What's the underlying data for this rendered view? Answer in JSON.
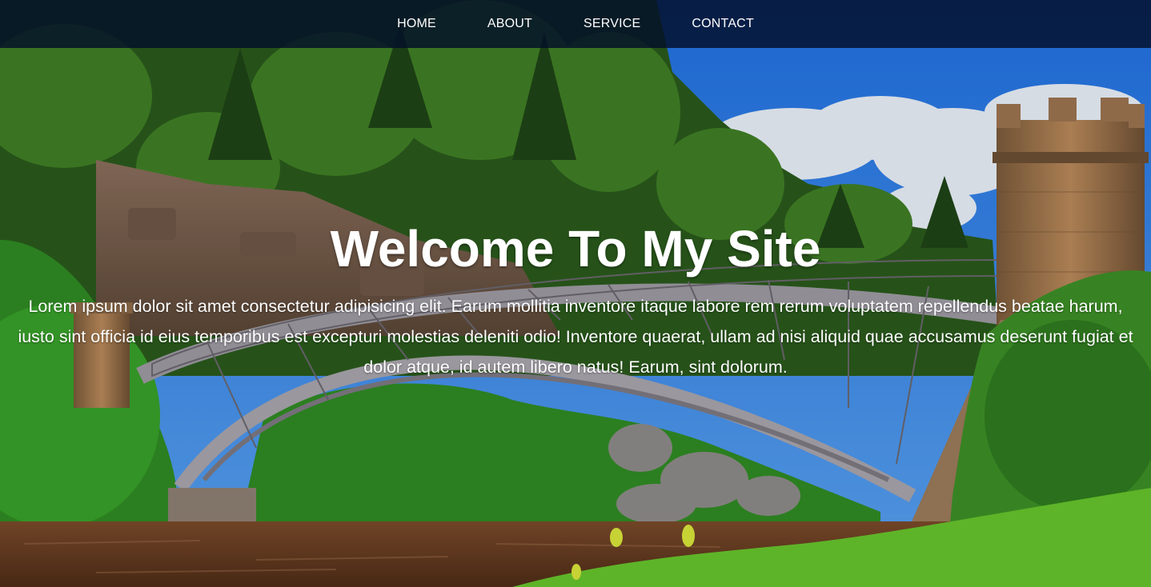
{
  "nav": {
    "items": [
      {
        "label": "HOME"
      },
      {
        "label": "ABOUT"
      },
      {
        "label": "SERVICE"
      },
      {
        "label": "CONTACT"
      }
    ]
  },
  "hero": {
    "title": "Welcome To My Site",
    "text": "Lorem ipsum dolor sit amet consectetur adipisicing elit. Earum mollitia inventore itaque labore rem rerum voluptatem repellendus beatae harum, iusto sint officia id eius temporibus est excepturi molestias deleniti odio! Inventore quaerat, ullam ad nisi aliquid quae accusamus deserunt fugiat et dolor atque, id autem libero natus! Earum, sint dolorum.",
    "background_image": "forest-bridge-castle-landscape"
  },
  "colors": {
    "navbar_bg": "#020e28",
    "text": "#ffffff",
    "sky": "#2f7ee8",
    "forest": "#2d6b1f",
    "river": "#6b3f24"
  }
}
